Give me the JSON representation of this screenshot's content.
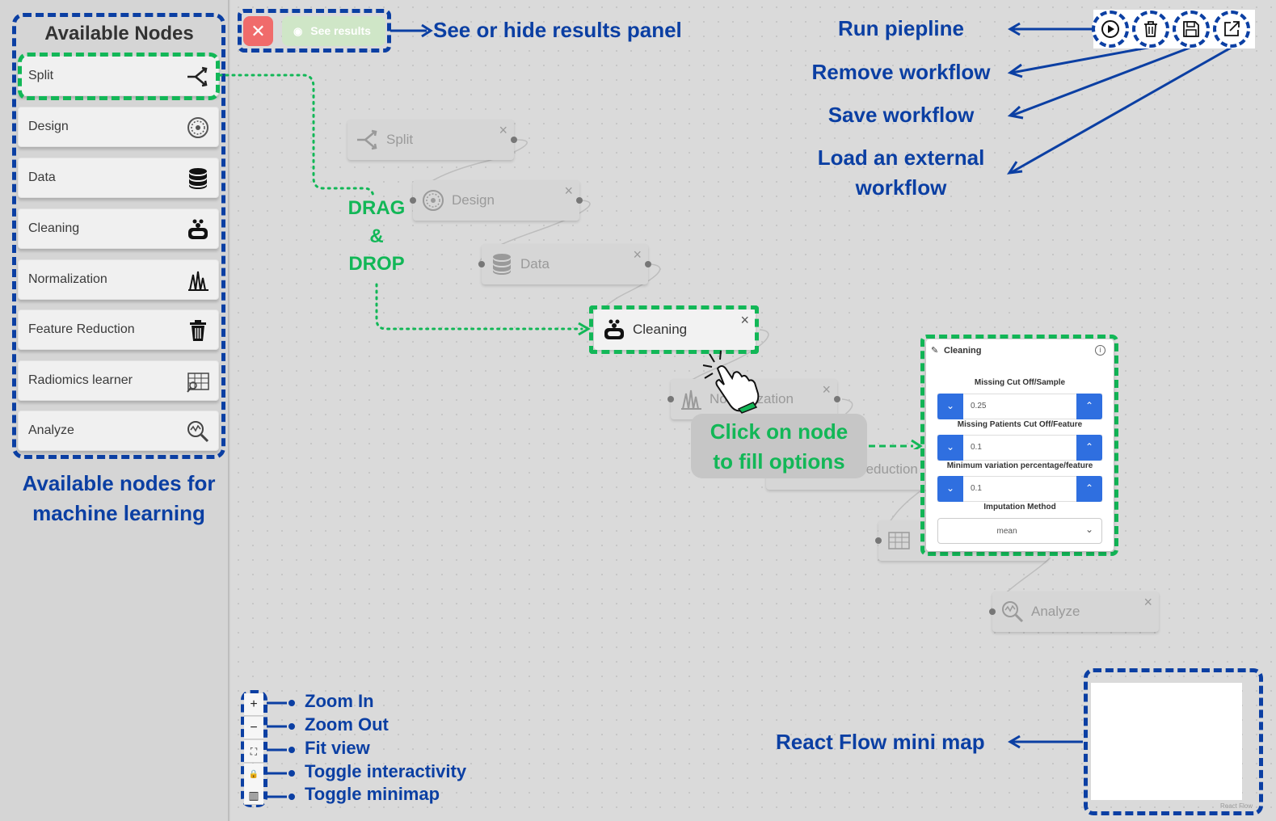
{
  "sidebar": {
    "title": "Available Nodes",
    "items": [
      {
        "label": "Split",
        "icon": "split-icon"
      },
      {
        "label": "Design",
        "icon": "design-icon"
      },
      {
        "label": "Data",
        "icon": "database-icon"
      },
      {
        "label": "Cleaning",
        "icon": "cleaning-icon"
      },
      {
        "label": "Normalization",
        "icon": "normalization-icon"
      },
      {
        "label": "Feature Reduction",
        "icon": "trash-icon"
      },
      {
        "label": "Radiomics learner",
        "icon": "radiomics-icon"
      },
      {
        "label": "Analyze",
        "icon": "analyze-icon"
      }
    ],
    "caption_line1": "Available nodes for",
    "caption_line2": "machine learning"
  },
  "toolbar": {
    "close_symbol": "✕",
    "see_results_label": "See results",
    "see_results_annotation": "See or hide results panel",
    "run_annotation": "Run piepline",
    "remove_annotation": "Remove workflow",
    "save_annotation": "Save workflow",
    "load_annotation_line1": "Load an external",
    "load_annotation_line2": "workflow"
  },
  "graph": {
    "nodes": {
      "split": "Split",
      "design": "Design",
      "data": "Data",
      "cleaning": "Cleaning",
      "normalization": "Normalization",
      "feature_reduction": "Feature Reduction",
      "analyze": "Analyze"
    },
    "close_symbol": "×",
    "drag_line1": "DRAG",
    "drag_line2": "&",
    "drag_line3": "DROP",
    "click_line1": "Click on node",
    "click_line2": "to fill options"
  },
  "panel": {
    "title": "Cleaning",
    "info": "i",
    "fields": [
      {
        "label": "Missing Cut Off/Sample",
        "value": "0.25"
      },
      {
        "label": "Missing Patients Cut Off/Feature",
        "value": "0.1"
      },
      {
        "label": "Minimum variation percentage/feature",
        "value": "0.1"
      }
    ],
    "imputation_label": "Imputation Method",
    "imputation_value": "mean"
  },
  "controls": {
    "items": [
      {
        "symbol": "+",
        "label": "Zoom In"
      },
      {
        "symbol": "−",
        "label": "Zoom Out"
      },
      {
        "symbol": "⛶",
        "label": "Fit view"
      },
      {
        "symbol": "🔒",
        "label": "Toggle interactivity"
      },
      {
        "symbol": "▥",
        "label": "Toggle minimap"
      }
    ]
  },
  "minimap": {
    "annotation": "React Flow mini map",
    "attribution": "React Flow"
  },
  "colors": {
    "annotation_blue": "#0b3fa3",
    "highlight_green": "#12b757",
    "stepper_blue": "#2f6fe0"
  }
}
